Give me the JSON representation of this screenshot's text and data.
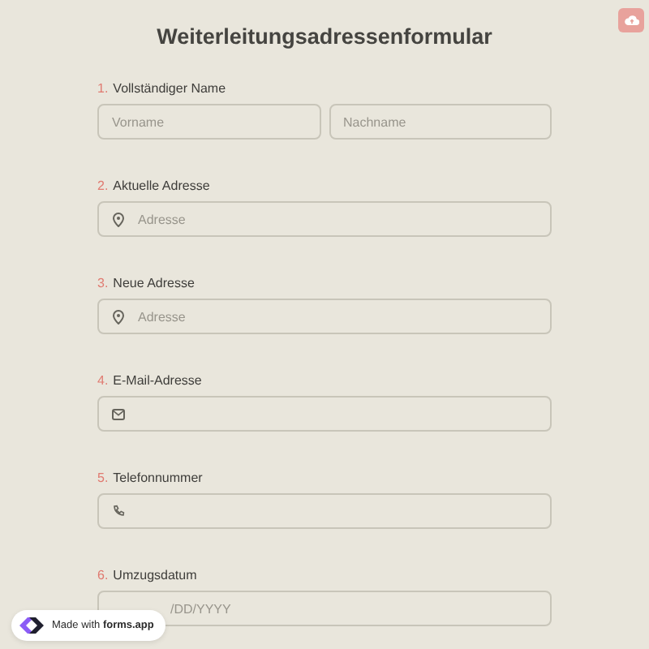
{
  "title": "Weiterleitungsadressenformular",
  "questions": [
    {
      "number": "1.",
      "label": "Vollständiger Name",
      "kind": "name",
      "fields": [
        {
          "placeholder": "Vorname"
        },
        {
          "placeholder": "Nachname"
        }
      ]
    },
    {
      "number": "2.",
      "label": "Aktuelle Adresse",
      "kind": "address",
      "fields": [
        {
          "placeholder": "Adresse"
        }
      ]
    },
    {
      "number": "3.",
      "label": "Neue Adresse",
      "kind": "address",
      "fields": [
        {
          "placeholder": "Adresse"
        }
      ]
    },
    {
      "number": "4.",
      "label": "E-Mail-Adresse",
      "kind": "email"
    },
    {
      "number": "5.",
      "label": "Telefonnummer",
      "kind": "phone"
    },
    {
      "number": "6.",
      "label": "Umzugsdatum",
      "kind": "date",
      "fields": [
        {
          "placeholder": "/DD/YYYY"
        }
      ]
    }
  ],
  "badge": {
    "text": "Made with **forms.app**"
  }
}
